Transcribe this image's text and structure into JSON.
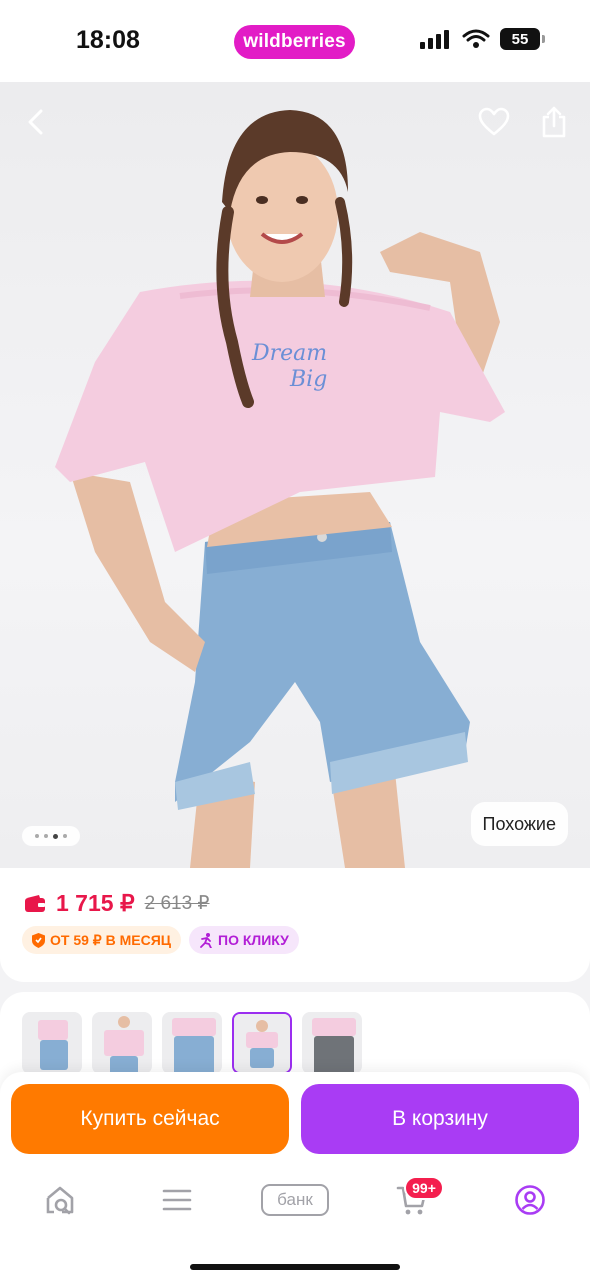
{
  "status_bar": {
    "time": "18:08",
    "brand": "wildberries",
    "battery": "55"
  },
  "hero": {
    "similar_label": "Похожие"
  },
  "price": {
    "current": "1 715 ₽",
    "old": "2 613 ₽"
  },
  "badges": [
    {
      "label": "ОТ 59 ₽ В МЕСЯЦ",
      "color": "#ff6a00"
    },
    {
      "label": "ПО КЛИКУ",
      "color": "#b21ed6"
    }
  ],
  "actions": {
    "buy_now": "Купить сейчас",
    "add_to_cart": "В корзину"
  },
  "tabbar": {
    "bank_label": "банк",
    "cart_count": "99+"
  },
  "colors": {
    "brand": "#e21cc6",
    "buy": "#ff7a00",
    "cart": "#a93cf4",
    "price": "#e8174a"
  }
}
